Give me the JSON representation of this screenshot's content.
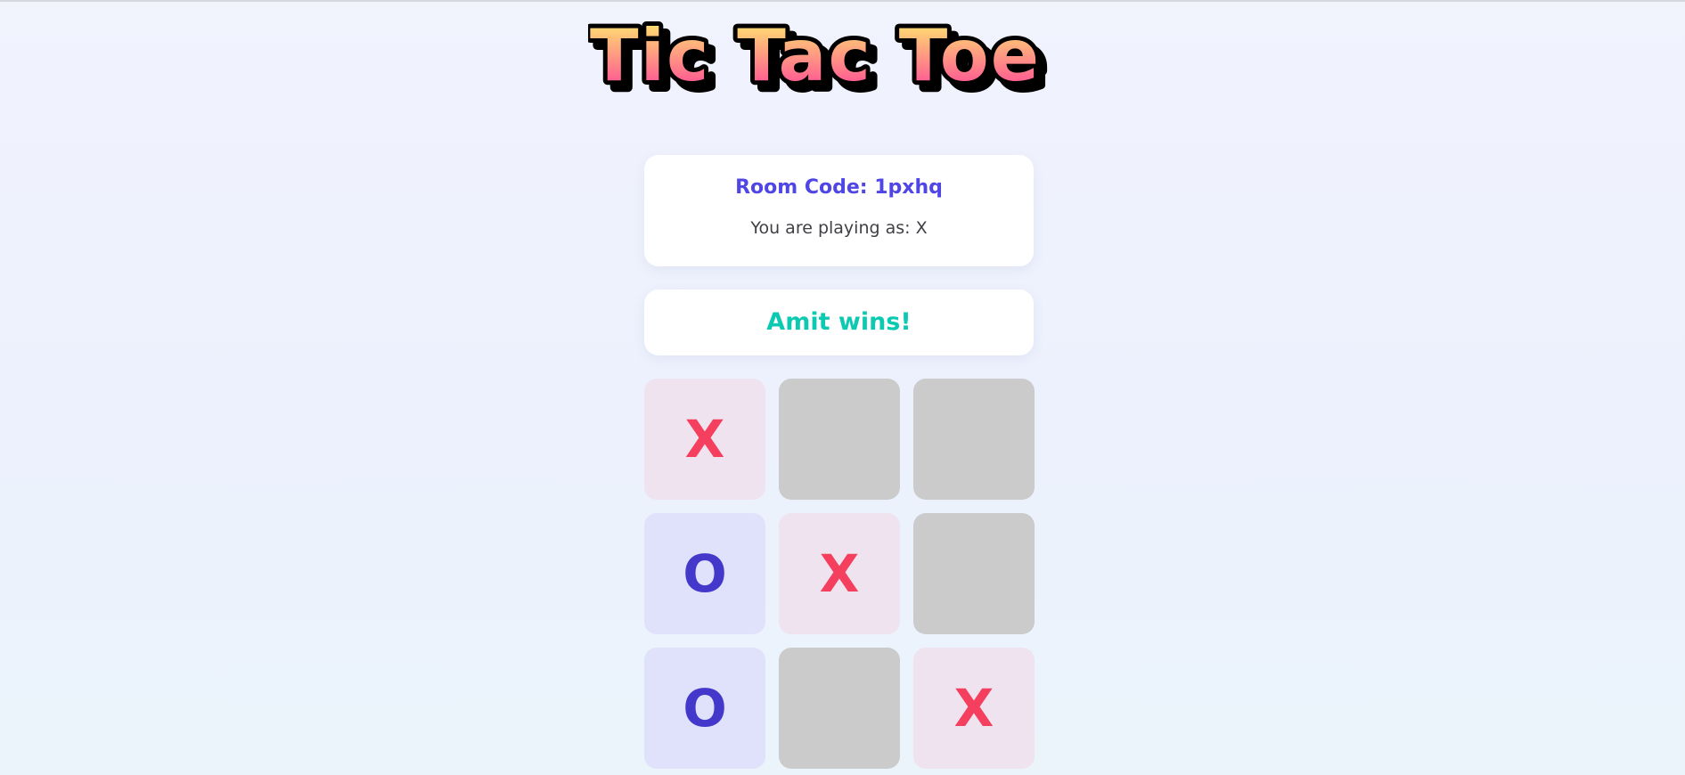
{
  "header": {
    "title": "Tic Tac Toe"
  },
  "room": {
    "label": "Room Code:",
    "code": "1pxhq",
    "playing_as": "You are playing as: X"
  },
  "status": {
    "message": "Amit wins!"
  },
  "board": {
    "cells": [
      "X",
      "",
      "",
      "O",
      "X",
      "",
      "O",
      "",
      "X"
    ]
  },
  "colors": {
    "x_mark": "#f43f5e",
    "o_mark": "#4338ca",
    "x_cell_bg": "#eee3ee",
    "o_cell_bg": "#e0e1fb",
    "empty_cell_bg": "#cbcbcb",
    "status_text": "#0cc9b2",
    "room_code_text": "#4f46e5",
    "title_gradient_top": "#fff36b",
    "title_gradient_bottom": "#ff3d9a"
  }
}
